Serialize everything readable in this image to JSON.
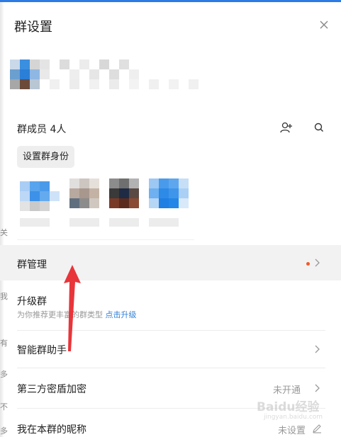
{
  "panel": {
    "title": "群设置",
    "close_icon": "close-icon"
  },
  "members": {
    "title": "群成员 4人",
    "add_icon": "add-member-icon",
    "search_icon": "search-icon",
    "role_button": "设置群身份"
  },
  "rows": [
    {
      "label": "群管理",
      "has_dot": true,
      "chevron": true
    },
    {
      "label": "升级群",
      "sub_prefix": "为你推荐更丰富的群类型 ",
      "sub_link": "点击升级"
    },
    {
      "label": "智能群助手",
      "chevron": true
    },
    {
      "label": "第三方密盾加密",
      "value": "未开通",
      "chevron": true
    },
    {
      "label": "我在本群的昵称",
      "value": "未设置",
      "edit_icon": "pencil-icon"
    }
  ],
  "annotation": {
    "arrow_color": "#e8353a"
  },
  "watermark": {
    "text": "Baidu经验",
    "sub": "jingyan.baidu.com"
  },
  "left_edge_chars": [
    "关",
    "我",
    "有",
    "多",
    "不",
    "多"
  ],
  "colors": {
    "accent": "#2c7be5",
    "link": "#2f7fd8",
    "dot": "#f05a28",
    "highlight_row": "#f2f2f2"
  }
}
